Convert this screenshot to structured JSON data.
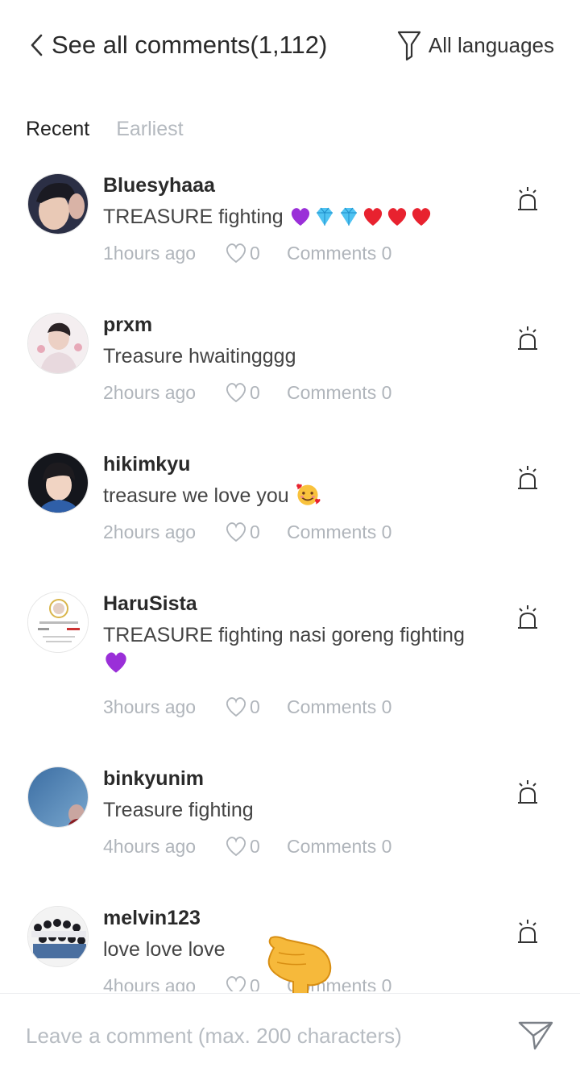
{
  "header": {
    "title": "See all comments(1,112)",
    "filter_label": "All languages"
  },
  "tabs": [
    {
      "label": "Recent",
      "active": true
    },
    {
      "label": "Earliest",
      "active": false
    }
  ],
  "comments": [
    {
      "username": "Bluesyhaaa",
      "text": "TREASURE fighting",
      "emojis": [
        "purple-heart",
        "diamond",
        "diamond",
        "red-heart",
        "red-heart",
        "red-heart"
      ],
      "time": "1hours ago",
      "likes": "0",
      "comments": "Comments 0"
    },
    {
      "username": "prxm",
      "text": "Treasure hwaitingggg",
      "emojis": [],
      "time": "2hours ago",
      "likes": "0",
      "comments": "Comments 0"
    },
    {
      "username": "hikimkyu",
      "text": "treasure we love you",
      "emojis": [
        "smiling-face-with-hearts"
      ],
      "time": "2hours ago",
      "likes": "0",
      "comments": "Comments 0"
    },
    {
      "username": "HaruSista",
      "text": "TREASURE fighting nasi goreng fighting",
      "emojis": [
        "purple-heart"
      ],
      "time": "3hours ago",
      "likes": "0",
      "comments": "Comments 0"
    },
    {
      "username": "binkyunim",
      "text": "Treasure fighting",
      "emojis": [],
      "time": "4hours ago",
      "likes": "0",
      "comments": "Comments 0"
    },
    {
      "username": "melvin123",
      "text": "love love love",
      "emojis": [],
      "time": "4hours ago",
      "likes": "0",
      "comments": "Comments 0"
    }
  ],
  "footer": {
    "placeholder": "Leave a comment (max. 200 characters)"
  },
  "colors": {
    "muted": "#b0b5bb",
    "tab_inactive": "#b4b9bf",
    "text": "#2a2a2a"
  }
}
